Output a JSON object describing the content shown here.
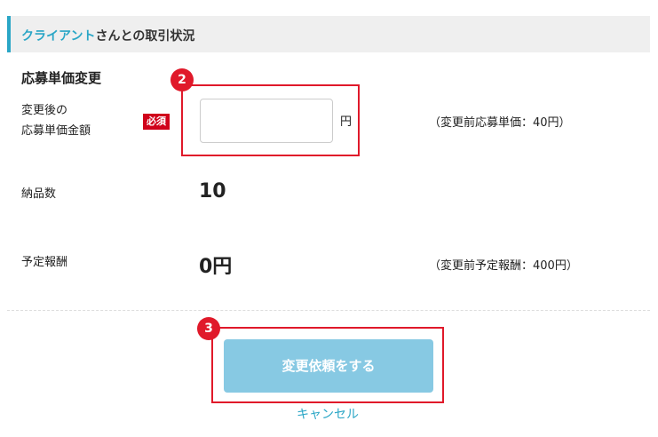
{
  "header": {
    "client_name": "クライアント",
    "title_suffix": "さんとの取引状況"
  },
  "section": {
    "title": "応募単価変更"
  },
  "form": {
    "new_price_label_line1": "変更後の",
    "new_price_label_line2": "応募単価金額",
    "required_badge": "必須",
    "new_price_value": "",
    "unit": "円",
    "previous_price_note": "（変更前応募単価：40円）"
  },
  "delivery": {
    "label": "納品数",
    "value": "10"
  },
  "reward": {
    "label": "予定報酬",
    "value": "0円",
    "previous_note": "（変更前予定報酬：400円）"
  },
  "actions": {
    "submit_label": "変更依頼をする",
    "cancel_label": "キャンセル"
  },
  "annotations": {
    "step_input": "2",
    "step_submit": "3"
  },
  "colors": {
    "accent": "#2aa6c6",
    "required": "#d0021b",
    "highlight": "#e0192a",
    "submit_button": "#87c9e3"
  }
}
